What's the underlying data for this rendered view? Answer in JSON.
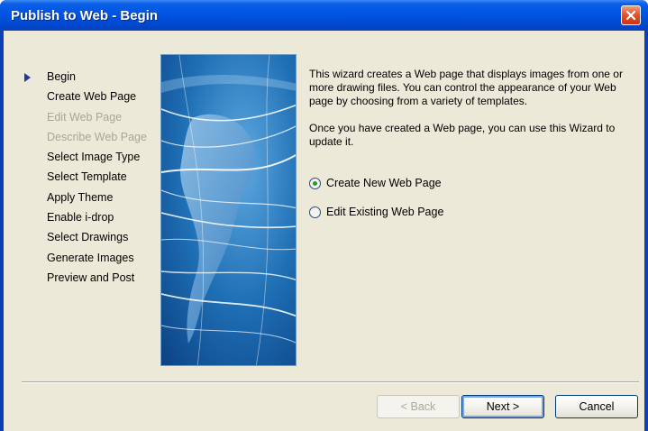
{
  "window": {
    "title": "Publish to Web - Begin",
    "close_icon": "close-icon"
  },
  "steps": [
    {
      "label": "Begin",
      "state": "current"
    },
    {
      "label": "Create Web Page",
      "state": "enabled"
    },
    {
      "label": "Edit Web Page",
      "state": "disabled"
    },
    {
      "label": "Describe Web Page",
      "state": "disabled"
    },
    {
      "label": "Select Image Type",
      "state": "enabled"
    },
    {
      "label": "Select Template",
      "state": "enabled"
    },
    {
      "label": "Apply Theme",
      "state": "enabled"
    },
    {
      "label": "Enable i-drop",
      "state": "enabled"
    },
    {
      "label": "Select Drawings",
      "state": "enabled"
    },
    {
      "label": "Generate Images",
      "state": "enabled"
    },
    {
      "label": "Preview and Post",
      "state": "enabled"
    }
  ],
  "description": {
    "paragraph1": "This wizard creates a Web page that displays images from one or more drawing files.  You can control the appearance of your Web page by choosing from a variety of templates.",
    "paragraph2": "Once you have created a Web page, you can use this Wizard to update it."
  },
  "options": [
    {
      "label": "Create New Web Page",
      "checked": true
    },
    {
      "label": "Edit Existing Web Page",
      "checked": false
    }
  ],
  "buttons": {
    "back": "< Back",
    "next": "Next >",
    "cancel": "Cancel"
  },
  "colors": {
    "titlebar": "#0054e3",
    "dialog_bg": "#ece9d8",
    "disabled_text": "#a8a69a",
    "hero_blue": "#1b5fa6"
  }
}
